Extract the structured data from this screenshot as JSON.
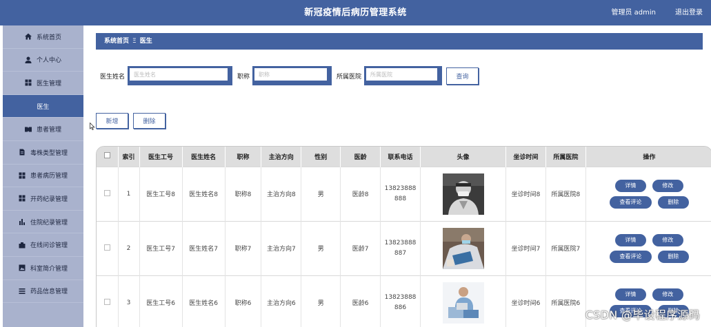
{
  "header": {
    "title": "新冠疫情后病历管理系统",
    "user_label": "管理员 admin",
    "logout_label": "退出登录"
  },
  "sidebar": {
    "items": [
      {
        "label": "系统首页",
        "icon": "home-icon"
      },
      {
        "label": "个人中心",
        "icon": "user-icon"
      },
      {
        "label": "医生管理",
        "icon": "grid-icon"
      },
      {
        "label": "医生",
        "icon": "",
        "active": true
      },
      {
        "label": "患者管理",
        "icon": "id-card-icon"
      },
      {
        "label": "毒株类型管理",
        "icon": "document-icon"
      },
      {
        "label": "患者病历管理",
        "icon": "grid-icon"
      },
      {
        "label": "开药纪录管理",
        "icon": "grid-icon"
      },
      {
        "label": "住院纪录管理",
        "icon": "bar-chart-icon"
      },
      {
        "label": "在线问诊管理",
        "icon": "briefcase-icon"
      },
      {
        "label": "科室简介管理",
        "icon": "image-icon"
      },
      {
        "label": "药品信息管理",
        "icon": "list-icon"
      }
    ]
  },
  "breadcrumb": {
    "home": "系统首页",
    "separator": "Ξ",
    "current": "医生"
  },
  "search": {
    "name_label": "医生姓名",
    "name_placeholder": "医生姓名",
    "title_label": "职称",
    "title_placeholder": "职称",
    "hospital_label": "所属医院",
    "hospital_placeholder": "所属医院",
    "query_label": "查询"
  },
  "actions": {
    "add_label": "新增",
    "delete_label": "删除"
  },
  "table": {
    "headers": {
      "index": "索引",
      "doctor_no": "医生工号",
      "doctor_name": "医生姓名",
      "title": "职称",
      "direction": "主治方向",
      "gender": "性别",
      "age": "医龄",
      "phone": "联系电话",
      "avatar": "头像",
      "hours": "坐诊时间",
      "hospital": "所属医院",
      "ops": "操作"
    },
    "rows": [
      {
        "index": "1",
        "doctor_no": "医生工号8",
        "doctor_name": "医生姓名8",
        "title": "职称8",
        "direction": "主治方向8",
        "gender": "男",
        "age": "医龄8",
        "phone_a": "13823888",
        "phone_b": "888",
        "hours": "坐诊时间8",
        "hospital": "所属医院8"
      },
      {
        "index": "2",
        "doctor_no": "医生工号7",
        "doctor_name": "医生姓名7",
        "title": "职称7",
        "direction": "主治方向7",
        "gender": "男",
        "age": "医龄7",
        "phone_a": "13823888",
        "phone_b": "887",
        "hours": "坐诊时间7",
        "hospital": "所属医院7"
      },
      {
        "index": "3",
        "doctor_no": "医生工号6",
        "doctor_name": "医生姓名6",
        "title": "职称6",
        "direction": "主治方向6",
        "gender": "男",
        "age": "医龄6",
        "phone_a": "13823888",
        "phone_b": "886",
        "hours": "坐诊时间6",
        "hospital": "所属医院6"
      }
    ],
    "op_labels": {
      "detail": "详情",
      "edit": "修改",
      "reviews": "查看评论",
      "delete": "删除"
    }
  },
  "watermark": "CSDN @毕设程序源码",
  "colors": {
    "primary": "#4362a0",
    "sidebar_bg": "#a9b2cd",
    "table_header_bg": "#dedede"
  }
}
